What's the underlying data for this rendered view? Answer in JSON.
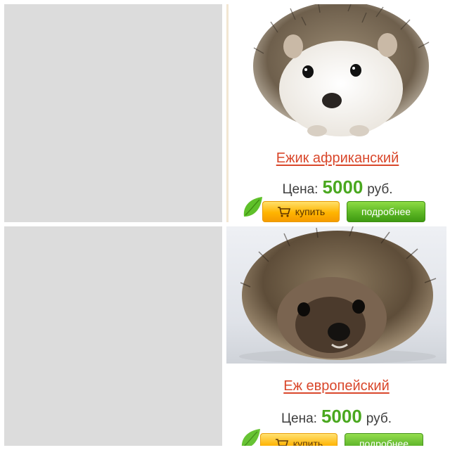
{
  "products": [
    {
      "name": "Ежик африканский",
      "price_label": "Цена:",
      "price_value": "5000",
      "currency": "руб.",
      "buy_label": "купить",
      "details_label": "подробнее",
      "photo_icon": "african-hedgehog-photo"
    },
    {
      "name": "Еж европейский",
      "price_label": "Цена:",
      "price_value": "5000",
      "currency": "руб.",
      "buy_label": "купить",
      "details_label": "подробнее",
      "photo_icon": "european-hedgehog-photo"
    }
  ],
  "colors": {
    "placeholder": "#dcdcdc",
    "name_link": "#d9472b",
    "price": "#4aa81f",
    "buy_button": "#ffb400",
    "details_button": "#5cb624"
  }
}
